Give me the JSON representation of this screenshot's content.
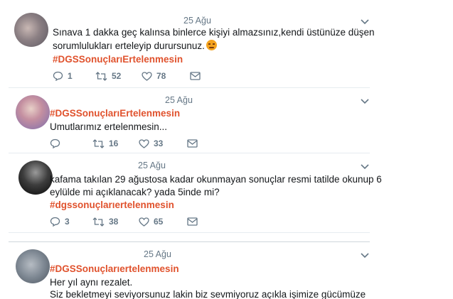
{
  "colors": {
    "hashtag": "#e0522d",
    "muted": "#657786",
    "text": "#14171a"
  },
  "tweets": [
    {
      "date": "25 Ağu",
      "lines": [
        "Sınava 1 dakka geç kalınsa binlerce kişiyi almazsınız,kendi üstünüze düşen",
        "sorumlulukları erteleyip durursunuz."
      ],
      "hashtag": "#DGSSonuçlarıErtelenmesin",
      "emoji": "angry-face",
      "reply_count": "1",
      "retweet_count": "52",
      "like_count": "78"
    },
    {
      "date": "25 Ağu",
      "hashtag": "#DGSSonuçlarıErtelenmesin",
      "lines": [
        "Umutlarımız ertelenmesin..."
      ],
      "reply_count": "",
      "retweet_count": "16",
      "like_count": "33"
    },
    {
      "date": "25 Ağu",
      "lines": [
        "kafama takılan 29 ağustosa kadar okunmayan sonuçlar resmi tatilde okunup 6",
        "eylülde mi açıklanacak? yada 5inde mi?"
      ],
      "hashtag": "#dgssonuçlarıertelenmesin",
      "reply_count": "3",
      "retweet_count": "38",
      "like_count": "65"
    },
    {
      "date": "25 Ağu",
      "hashtag": "#DGSSonuçlarıertelenmesin",
      "lines": [
        "Her yıl aynı rezalet.",
        "Siz bekletmeyi seviyorsunuz lakin biz sevmiyoruz açıkla işimize gücümüze"
      ]
    }
  ]
}
